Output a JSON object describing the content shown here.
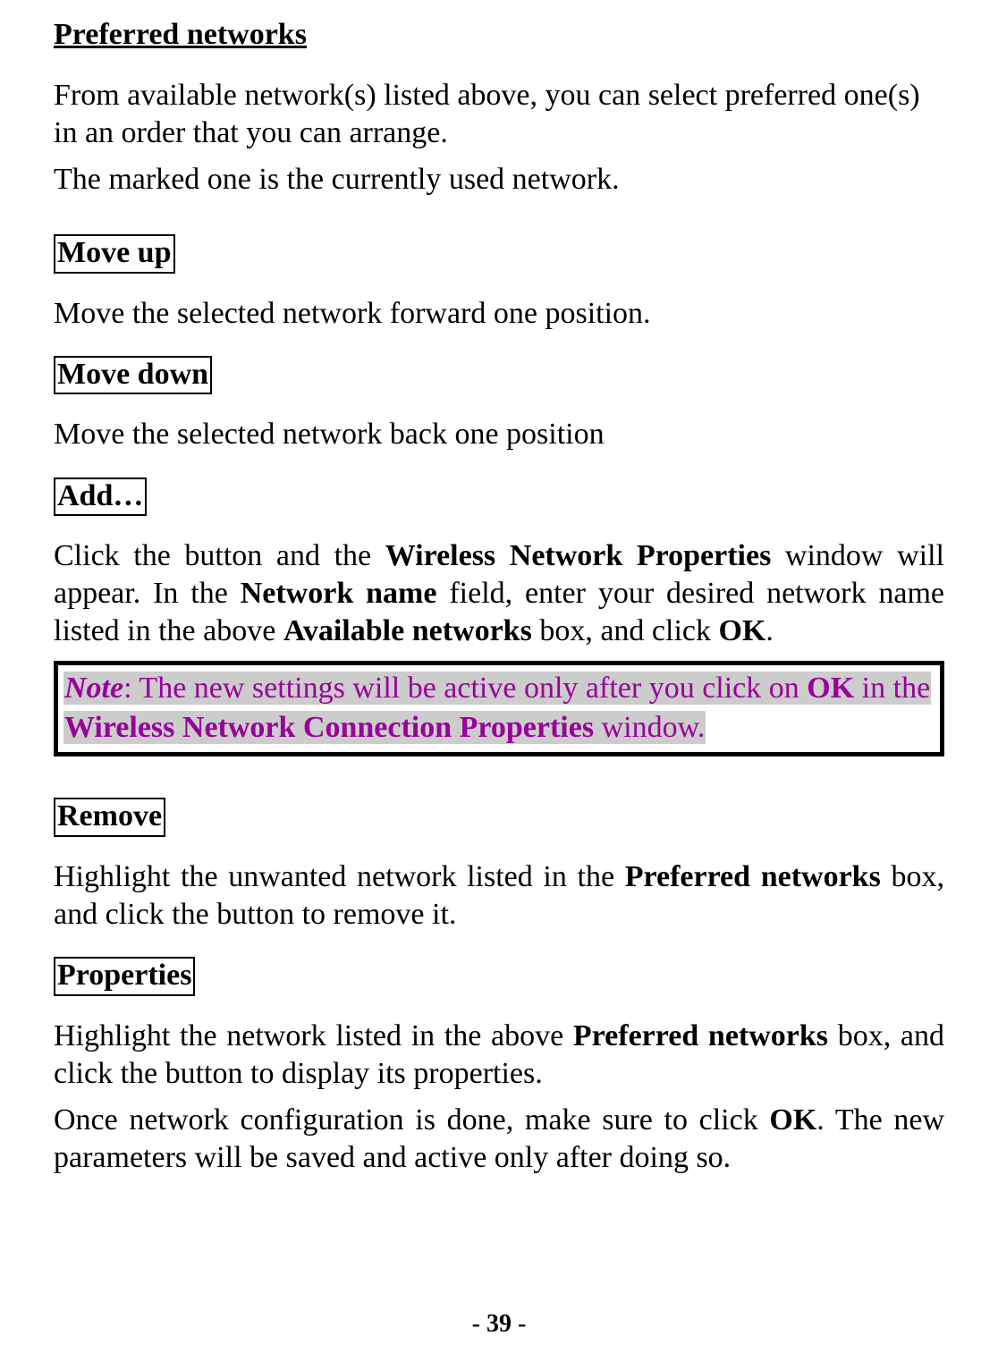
{
  "heading_preferred_networks": "Preferred networks",
  "para_intro1": "From available network(s) listed above, you can select preferred one(s) in an order that you can arrange.",
  "para_intro2": "The marked one is the currently used network.",
  "label_moveup": "Move up",
  "para_moveup": "Move the selected network forward one position.",
  "label_movedown": "Move down",
  "para_movedown": "Move the selected network back one position",
  "label_add": "Add…",
  "add_para": {
    "pre1": "Click the button and the ",
    "b1": "Wireless Network Properties",
    "mid1": " window will appear.   In the ",
    "b2": "Network name",
    "mid2": " field, enter your desired network name listed in the above ",
    "b3": "Available networks",
    "mid3": " box, and click ",
    "b4": "OK",
    "post": "."
  },
  "note": {
    "pre": "Note",
    "mid1": ": The new settings will be active only after you click on ",
    "b1": "OK",
    "mid2": " in the ",
    "b2": "Wireless Network Connection Properties",
    "mid3": " window."
  },
  "label_remove": "Remove",
  "remove_para": {
    "pre": "Highlight the unwanted network listed in the ",
    "b1": "Preferred networks",
    "post": " box, and click the button to remove it."
  },
  "label_properties": "Properties",
  "properties_para": {
    "pre": "Highlight the network listed in the above ",
    "b1": "Preferred networks",
    "post": " box, and click the button to display its properties."
  },
  "closing_para": {
    "pre": "Once network configuration is done, make sure to click ",
    "b1": "OK",
    "post": ". The new parameters will be saved and active only after doing so."
  },
  "footer": {
    "dash1": "- ",
    "num": "39",
    "dash2": " -"
  }
}
